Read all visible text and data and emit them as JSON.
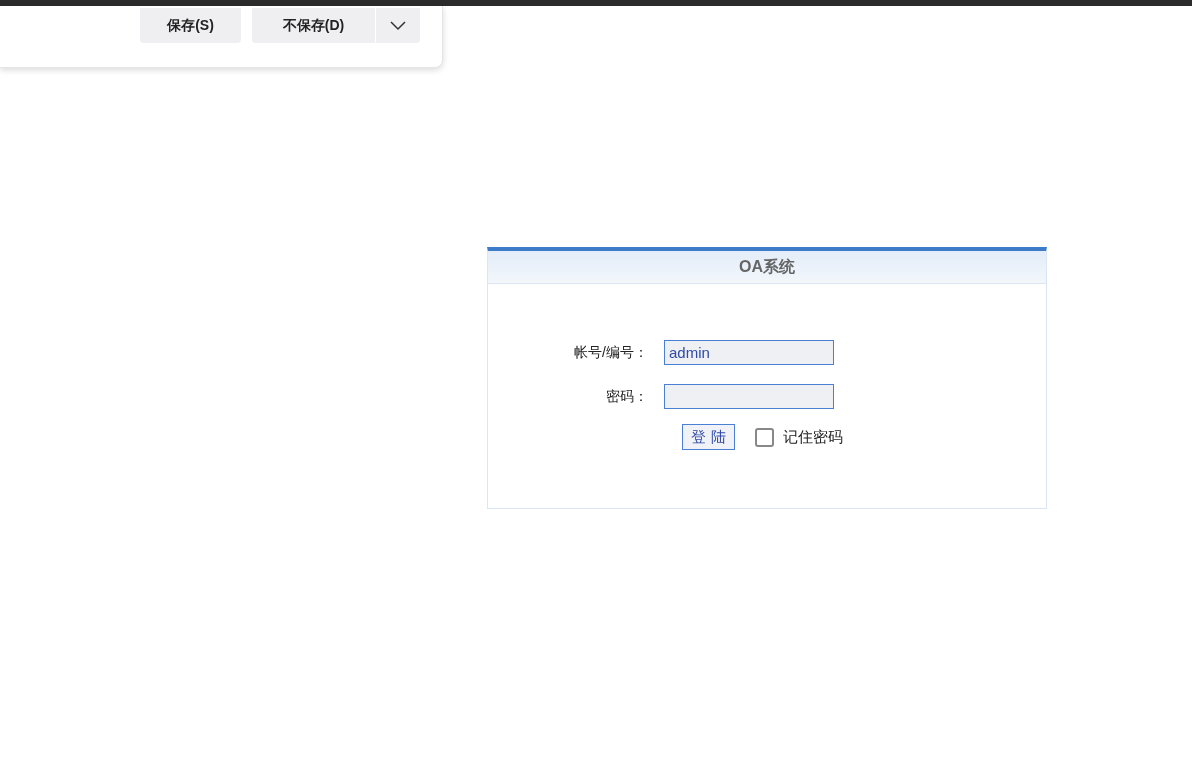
{
  "save_dialog": {
    "buttons": [
      {
        "label": "保存(S)"
      },
      {
        "label": "不保存(D)"
      }
    ]
  },
  "login": {
    "title": "OA系统",
    "fields": [
      {
        "label": "帐号/编号：",
        "value": "admin"
      },
      {
        "label": "密码："
      }
    ],
    "submit": "登 陆",
    "remember": {
      "label": "记住密码",
      "checked": false
    }
  }
}
